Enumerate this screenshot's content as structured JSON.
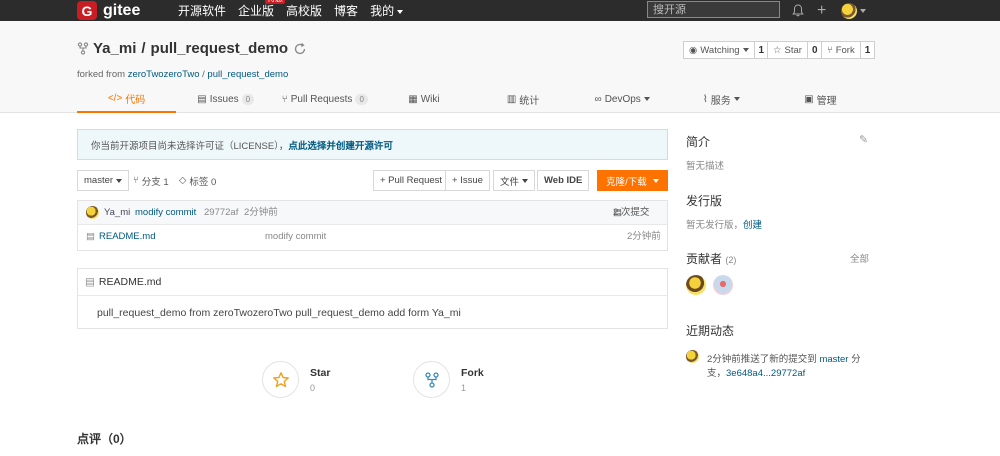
{
  "topnav": {
    "logo": "gitee",
    "links": [
      "开源软件",
      "企业版",
      "高校版",
      "博客",
      "我的"
    ],
    "hot_badge": "特惠",
    "search_placeholder": "搜开源"
  },
  "repo": {
    "owner": "Ya_mi",
    "name": "pull_request_demo",
    "forked_prefix": "forked from ",
    "forked_owner": "zeroTwozeroTwo",
    "forked_name": "pull_request_demo",
    "watching_label": "Watching",
    "watching_count": "1",
    "star_label": "Star",
    "star_count": "0",
    "fork_label": "Fork",
    "fork_count": "1"
  },
  "tabs": [
    {
      "label": "代码",
      "icon": "</>"
    },
    {
      "label": "Issues",
      "badge": "0"
    },
    {
      "label": "Pull Requests",
      "badge": "0"
    },
    {
      "label": "Wiki"
    },
    {
      "label": "统计"
    },
    {
      "label": "DevOps"
    },
    {
      "label": "服务"
    },
    {
      "label": "管理"
    }
  ],
  "license": {
    "text": "你当前开源项目尚未选择许可证（LICENSE），",
    "link": "点此选择并创建开源许可"
  },
  "toolbar": {
    "branch": "master",
    "branches": "分支 1",
    "tags": "标签 0",
    "pull_request": "+ Pull Request",
    "issue": "+ Issue",
    "file": "文件",
    "webide": "Web IDE",
    "clone": "克隆/下载"
  },
  "commit": {
    "author": "Ya_mi",
    "message": "modify commit",
    "hash": "29772af",
    "time": "2分钟前",
    "count": "2 次提交"
  },
  "files": [
    {
      "name": "README.md",
      "message": "modify commit",
      "time": "2分钟前"
    }
  ],
  "readme": {
    "title": "README.md",
    "content": "pull_request_demo from zeroTwozeroTwo pull_request_demo add form Ya_mi"
  },
  "social": {
    "star_label": "Star",
    "star_count": "0",
    "fork_label": "Fork",
    "fork_count": "1"
  },
  "comments_title": "点评（0）",
  "sidebar": {
    "intro_title": "简介",
    "intro_text": "暂无描述",
    "release_title": "发行版",
    "release_text": "暂无发行版，",
    "release_link": "创建",
    "contrib_title": "贡献者",
    "contrib_count": "(2)",
    "contrib_all": "全部",
    "activity_title": "近期动态",
    "activity_line1_a": "2分钟前推送了新的提交到 ",
    "activity_line1_branch": "master",
    "activity_line1_b": " 分",
    "activity_line2_a": "支，",
    "activity_line2_link": "3e648a4...29772af"
  }
}
